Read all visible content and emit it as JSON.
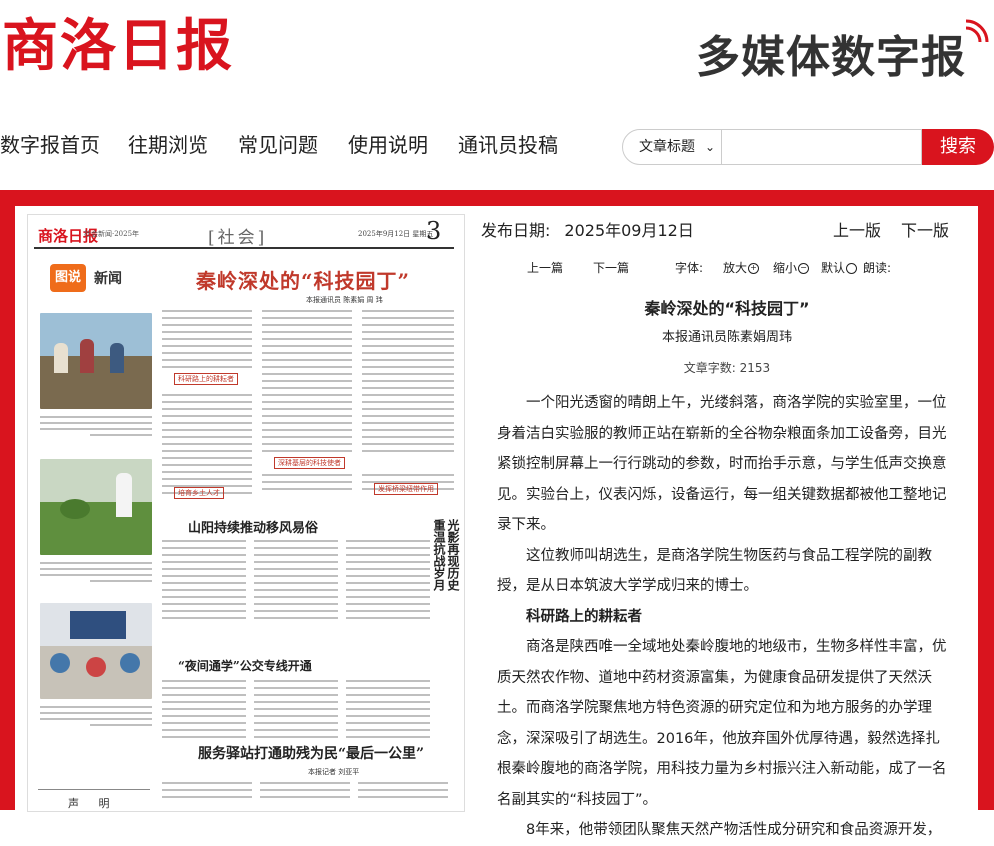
{
  "header": {
    "logo_text": "商洛日报",
    "brand_text": "多媒体数字报"
  },
  "nav": {
    "items": [
      "数字报首页",
      "往期浏览",
      "常见问题",
      "使用说明",
      "通讯员投稿"
    ],
    "search": {
      "select_value": "文章标题",
      "input_value": "",
      "button_label": "搜索"
    }
  },
  "colors": {
    "brand_red": "#d9141e",
    "text": "#222222"
  },
  "paper": {
    "masthead": "商洛日报",
    "masthead_small": "社会新闻·2025年",
    "section": "[社会]",
    "date_line": "2025年9月12日  星期五",
    "page_number": "3",
    "badge_box": "图说",
    "badge_text": "新闻",
    "headline_1": "秦岭深处的“科技园丁”",
    "byline_1": "本报通讯员  陈素娟  周  玮",
    "subhead_1": "科研路上的耕耘者",
    "subhead_2": "深耕基层的科技使者",
    "subhead_3": "培育乡土人才",
    "subhead_4": "发挥桥梁纽带作用",
    "headline_2": "山阳持续推动移风易俗",
    "headline_3": "“夜间通学”公交专线开通",
    "headline_4": "服务驿站打通助残为民“最后一公里”",
    "byline_4": "本报记者  刘亚平",
    "vertical_title_1": "光影再现历史",
    "vertical_title_2": "重温抗战岁月",
    "notice": "声  明"
  },
  "article": {
    "pubdate_label": "发布日期:",
    "pubdate_value": "2025年09月12日",
    "prev_edition": "上一版",
    "next_edition": "下一版",
    "prev_article": "上一篇",
    "next_article": "下一篇",
    "font_label": "字体:",
    "zoom_in": "放大",
    "zoom_out": "缩小",
    "default": "默认",
    "read_aloud": "朗读:",
    "title": "秦岭深处的“科技园丁”",
    "author": "本报通讯员陈素娟周玮",
    "word_count_label": "文章字数:",
    "word_count_value": "2153",
    "paragraphs": [
      {
        "text": "一个阳光透窗的晴朗上午，光缕斜落，商洛学院的实验室里，一位身着洁白实验服的教师正站在崭新的全谷物杂粮面条加工设备旁，目光紧锁控制屏幕上一行行跳动的参数，时而抬手示意，与学生低声交换意见。实验台上，仪表闪烁，设备运行，每一组关键数据都被他工整地记录下来。",
        "bold": false
      },
      {
        "text": "这位教师叫胡选生，是商洛学院生物医药与食品工程学院的副教授，是从日本筑波大学学成归来的博士。",
        "bold": false
      },
      {
        "text": "科研路上的耕耘者",
        "bold": true
      },
      {
        "text": "商洛是陕西唯一全域地处秦岭腹地的地级市，生物多样性丰富，优质天然农作物、道地中药材资源富集，为健康食品研发提供了天然沃土。而商洛学院聚焦地方特色资源的研究定位和为地方服务的办学理念，深深吸引了胡选生。2016年，他放弃国外优厚待遇，毅然选择扎根秦岭腹地的商洛学院，用科技力量为乡村振兴注入新动能，成了一名名副其实的“科技园丁”。",
        "bold": false
      },
      {
        "text": "8年来，他带领团队聚焦天然产物活性成分研究和食品资源开发，",
        "bold": false
      }
    ]
  }
}
